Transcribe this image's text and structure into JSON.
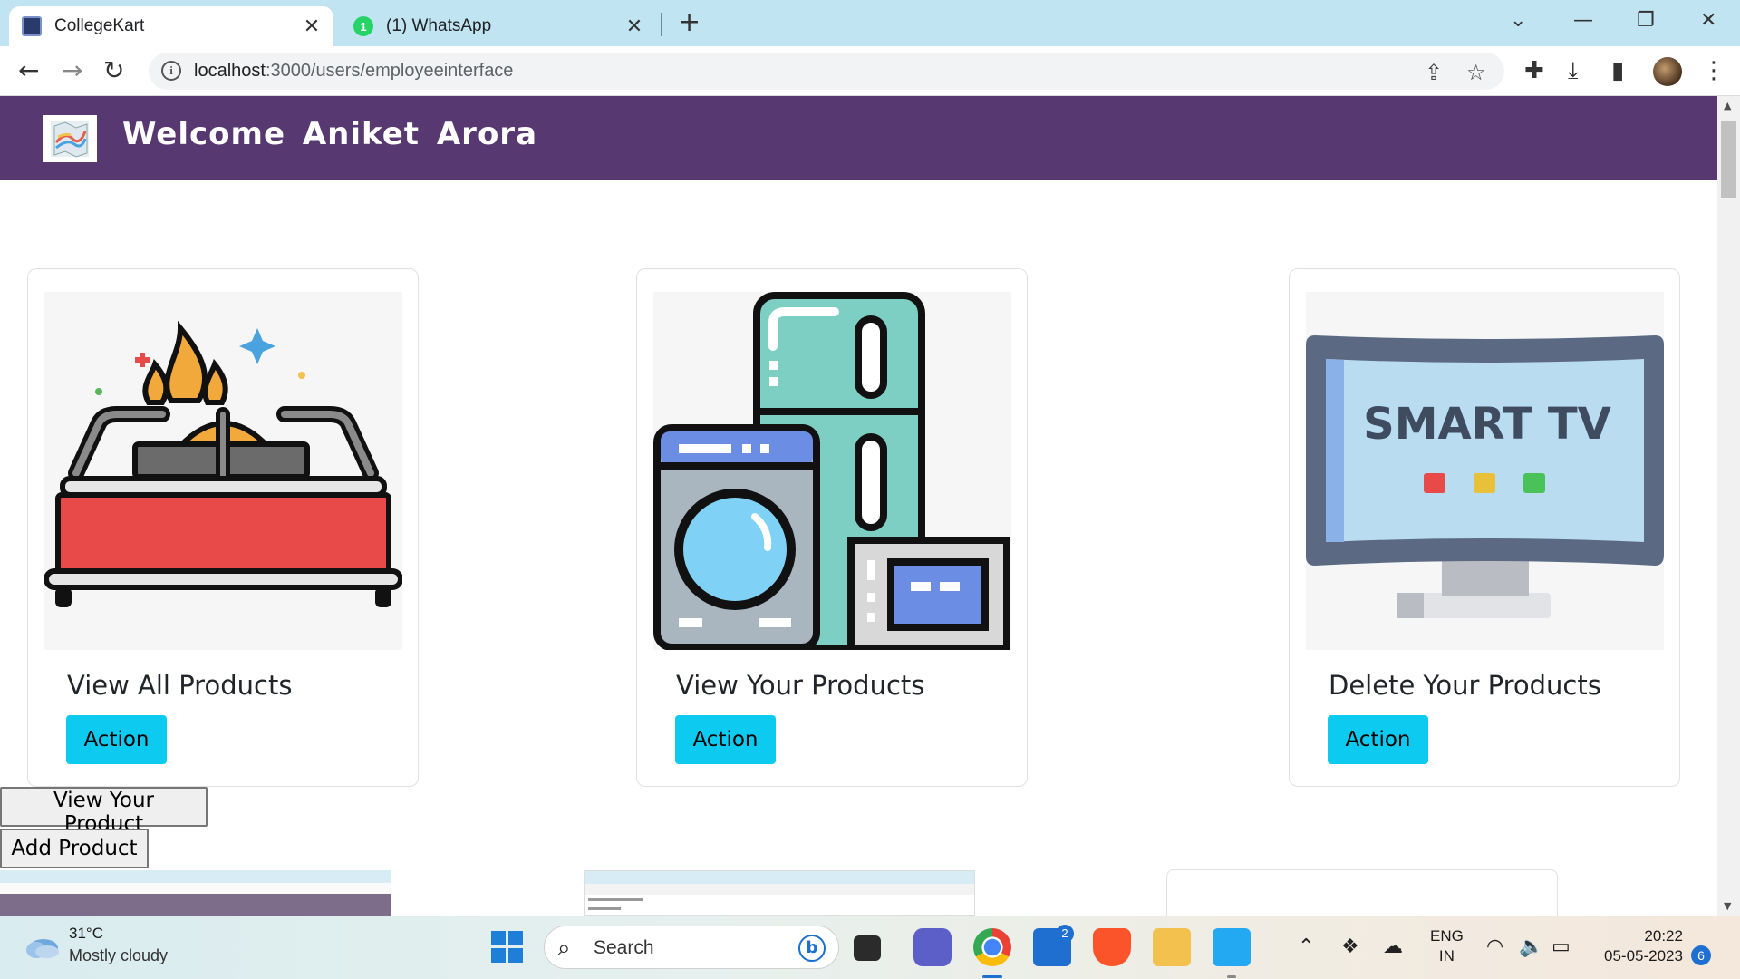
{
  "browser": {
    "tabs": [
      {
        "title": "CollegeKart",
        "icon": "collegekart-favicon"
      },
      {
        "title": "(1) WhatsApp",
        "icon": "whatsapp-favicon",
        "badge": "1"
      }
    ],
    "url_host": "localhost",
    "url_path": ":3000/users/employeeinterface"
  },
  "page": {
    "welcome": "Welcome Aniket Arora",
    "cards": [
      {
        "title": "View All Products",
        "action": "Action",
        "image": "gas-stove-illustration"
      },
      {
        "title": "View Your Products",
        "action": "Action",
        "image": "appliances-illustration"
      },
      {
        "title": "Delete Your Products",
        "action": "Action",
        "image": "smart-tv-illustration",
        "image_text": "SMART TV"
      }
    ],
    "buttons": {
      "view_product": "View Your Product",
      "add_product": "Add Product"
    }
  },
  "taskbar": {
    "temperature": "31°C",
    "condition": "Mostly cloudy",
    "search": "Search",
    "mail_badge": "2",
    "lang_1": "ENG",
    "lang_2": "IN",
    "time": "20:22",
    "date": "05-05-2023",
    "notifications": "6"
  },
  "colors": {
    "header": "#573871",
    "action_button": "#0dcaf0",
    "accent": "#1f6fd0"
  }
}
